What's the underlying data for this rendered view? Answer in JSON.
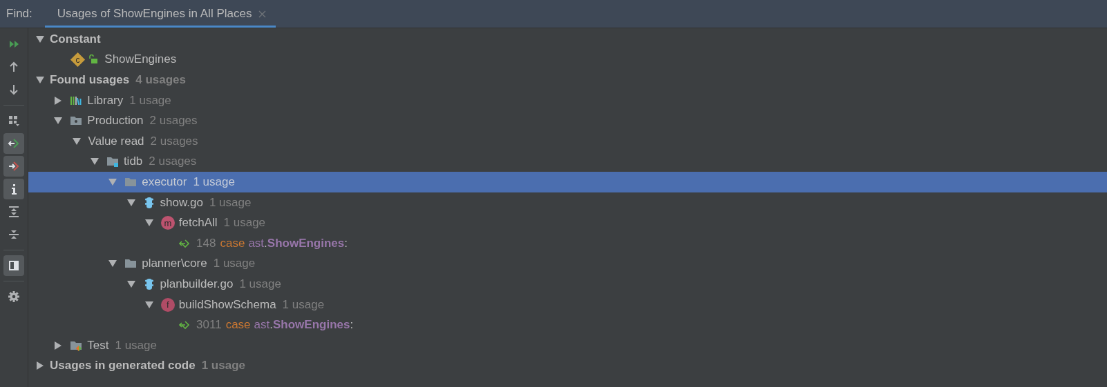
{
  "tool_window": {
    "label": "Find:",
    "tabs": [
      {
        "title": "Usages of ShowEngines in All Places",
        "selected": true,
        "closable": true
      }
    ]
  },
  "toolbar": [
    {
      "kind": "rerun",
      "on": false
    },
    {
      "kind": "up",
      "on": false
    },
    {
      "kind": "down",
      "on": false
    },
    {
      "kind": "separator"
    },
    {
      "kind": "group",
      "on": false
    },
    {
      "kind": "read",
      "on": true
    },
    {
      "kind": "write",
      "on": true
    },
    {
      "kind": "info",
      "on": true
    },
    {
      "kind": "expand",
      "on": false
    },
    {
      "kind": "collapse",
      "on": false
    },
    {
      "kind": "separator"
    },
    {
      "kind": "preview",
      "on": true
    },
    {
      "kind": "separator"
    },
    {
      "kind": "settings",
      "on": false
    }
  ],
  "tree": [
    {
      "kind": "group",
      "label": "Constant",
      "expanded": true,
      "selected": false,
      "children": [
        {
          "kind": "constant",
          "badge": "c",
          "label": "ShowEngines",
          "selected": false
        }
      ]
    },
    {
      "kind": "group",
      "label": "Found usages",
      "count": "4 usages",
      "expanded": true,
      "selected": false,
      "children": [
        {
          "kind": "library",
          "label": "Library",
          "count": "1 usage",
          "expanded": false,
          "selected": false
        },
        {
          "kind": "production",
          "label": "Production",
          "count": "2 usages",
          "expanded": true,
          "selected": false,
          "children": [
            {
              "kind": "category",
              "label": "Value read",
              "count": "2 usages",
              "expanded": true,
              "selected": false,
              "children": [
                {
                  "kind": "module",
                  "label": "tidb",
                  "count": "2 usages",
                  "expanded": true,
                  "selected": false,
                  "children": [
                    {
                      "kind": "folder",
                      "label": "executor",
                      "count": "1 usage",
                      "expanded": true,
                      "selected": true,
                      "children": [
                        {
                          "kind": "gofile",
                          "label": "show.go",
                          "count": "1 usage",
                          "expanded": true,
                          "selected": false,
                          "children": [
                            {
                              "kind": "method",
                              "badge": "m",
                              "label": "fetchAll",
                              "count": "1 usage",
                              "expanded": true,
                              "selected": false,
                              "children": [
                                {
                                  "kind": "usage",
                                  "line": "148",
                                  "code": {
                                    "keyword": "case",
                                    "package": "ast",
                                    "dot": ".",
                                    "member": "ShowEngines",
                                    "colon": ":"
                                  },
                                  "selected": false
                                }
                              ]
                            }
                          ]
                        }
                      ]
                    },
                    {
                      "kind": "folder",
                      "label": "planner\\core",
                      "count": "1 usage",
                      "expanded": true,
                      "selected": false,
                      "children": [
                        {
                          "kind": "gofile",
                          "label": "planbuilder.go",
                          "count": "1 usage",
                          "expanded": true,
                          "selected": false,
                          "children": [
                            {
                              "kind": "function",
                              "badge": "f",
                              "label": "buildShowSchema",
                              "count": "1 usage",
                              "expanded": true,
                              "selected": false,
                              "children": [
                                {
                                  "kind": "usage",
                                  "line": "3011",
                                  "code": {
                                    "keyword": "case",
                                    "package": "ast",
                                    "dot": ".",
                                    "member": "ShowEngines",
                                    "colon": ":"
                                  },
                                  "selected": false
                                }
                              ]
                            }
                          ]
                        }
                      ]
                    }
                  ]
                }
              ]
            }
          ]
        },
        {
          "kind": "test",
          "label": "Test",
          "count": "1 usage",
          "expanded": false,
          "selected": false
        }
      ]
    },
    {
      "kind": "group",
      "label": "Usages in generated code",
      "count": "1 usage",
      "expanded": false,
      "selected": false
    }
  ]
}
